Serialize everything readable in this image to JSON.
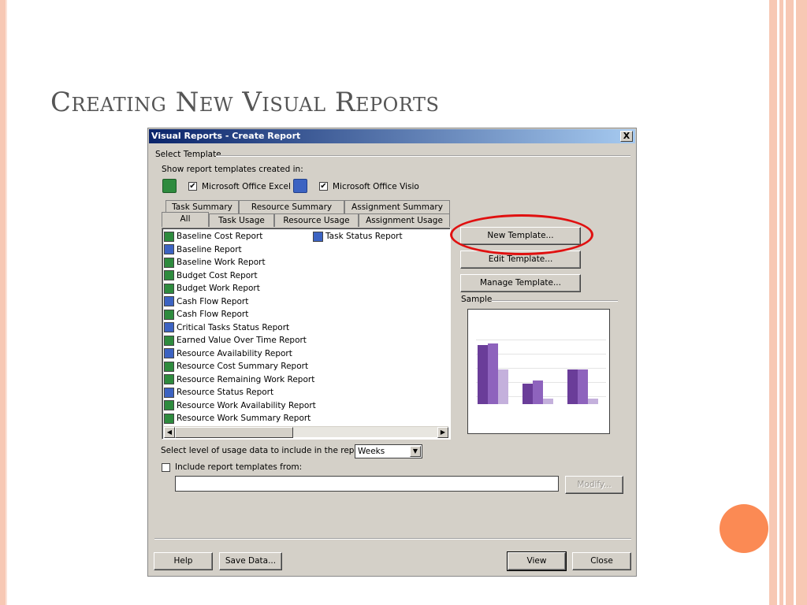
{
  "slide": {
    "title": "Creating New Visual Reports"
  },
  "dialog": {
    "title": "Visual Reports - Create Report",
    "close_glyph": "X",
    "select_template_label": "Select Template",
    "show_created_in_label": "Show report templates created in:",
    "excel_checkbox_label": "Microsoft Office Excel",
    "visio_checkbox_label": "Microsoft Office Visio",
    "excel_checked": true,
    "visio_checked": true,
    "tabs_back": [
      "Task Summary",
      "Resource Summary",
      "Assignment Summary"
    ],
    "tabs_front": [
      "All",
      "Task Usage",
      "Resource Usage",
      "Assignment Usage"
    ],
    "active_tab": "All",
    "reports_col1": [
      {
        "label": "Baseline Cost Report",
        "app": "excel"
      },
      {
        "label": "Baseline Report",
        "app": "visio"
      },
      {
        "label": "Baseline Work Report",
        "app": "excel"
      },
      {
        "label": "Budget Cost Report",
        "app": "excel"
      },
      {
        "label": "Budget Work Report",
        "app": "excel"
      },
      {
        "label": "Cash Flow Report",
        "app": "visio"
      },
      {
        "label": "Cash Flow Report",
        "app": "excel"
      },
      {
        "label": "Critical Tasks Status Report",
        "app": "visio"
      },
      {
        "label": "Earned Value Over Time Report",
        "app": "excel"
      },
      {
        "label": "Resource Availability Report",
        "app": "visio"
      },
      {
        "label": "Resource Cost Summary Report",
        "app": "excel"
      },
      {
        "label": "Resource Remaining Work Report",
        "app": "excel"
      },
      {
        "label": "Resource Status Report",
        "app": "visio"
      },
      {
        "label": "Resource Work Availability Report",
        "app": "excel"
      },
      {
        "label": "Resource Work Summary Report",
        "app": "excel"
      }
    ],
    "reports_col2": [
      {
        "label": "Task Status Report",
        "app": "visio"
      }
    ],
    "new_template_button": "New Template...",
    "edit_template_button": "Edit Template...",
    "manage_template_button": "Manage Template...",
    "sample_label": "Sample",
    "sample_chart": {
      "groups": [
        [
          0.94,
          0.96,
          0.55
        ],
        [
          0.32,
          0.37,
          0.09
        ],
        [
          0.55,
          0.55,
          0.09
        ]
      ]
    },
    "usage_level_label": "Select level of usage data to include in the report:",
    "usage_level_value": "Weeks",
    "include_templates_label": "Include report templates from:",
    "include_checked": false,
    "include_path_value": "",
    "modify_button": "Modify...",
    "help_button": "Help",
    "save_data_button": "Save Data...",
    "view_button": "View",
    "close_button": "Close",
    "colors": {
      "bar_dark": "#6a3d99",
      "bar_mid": "#8e63bd",
      "bar_light": "#c4b0dc",
      "highlight_oval": "#e01010",
      "accent_dot": "#fb8a54"
    }
  }
}
